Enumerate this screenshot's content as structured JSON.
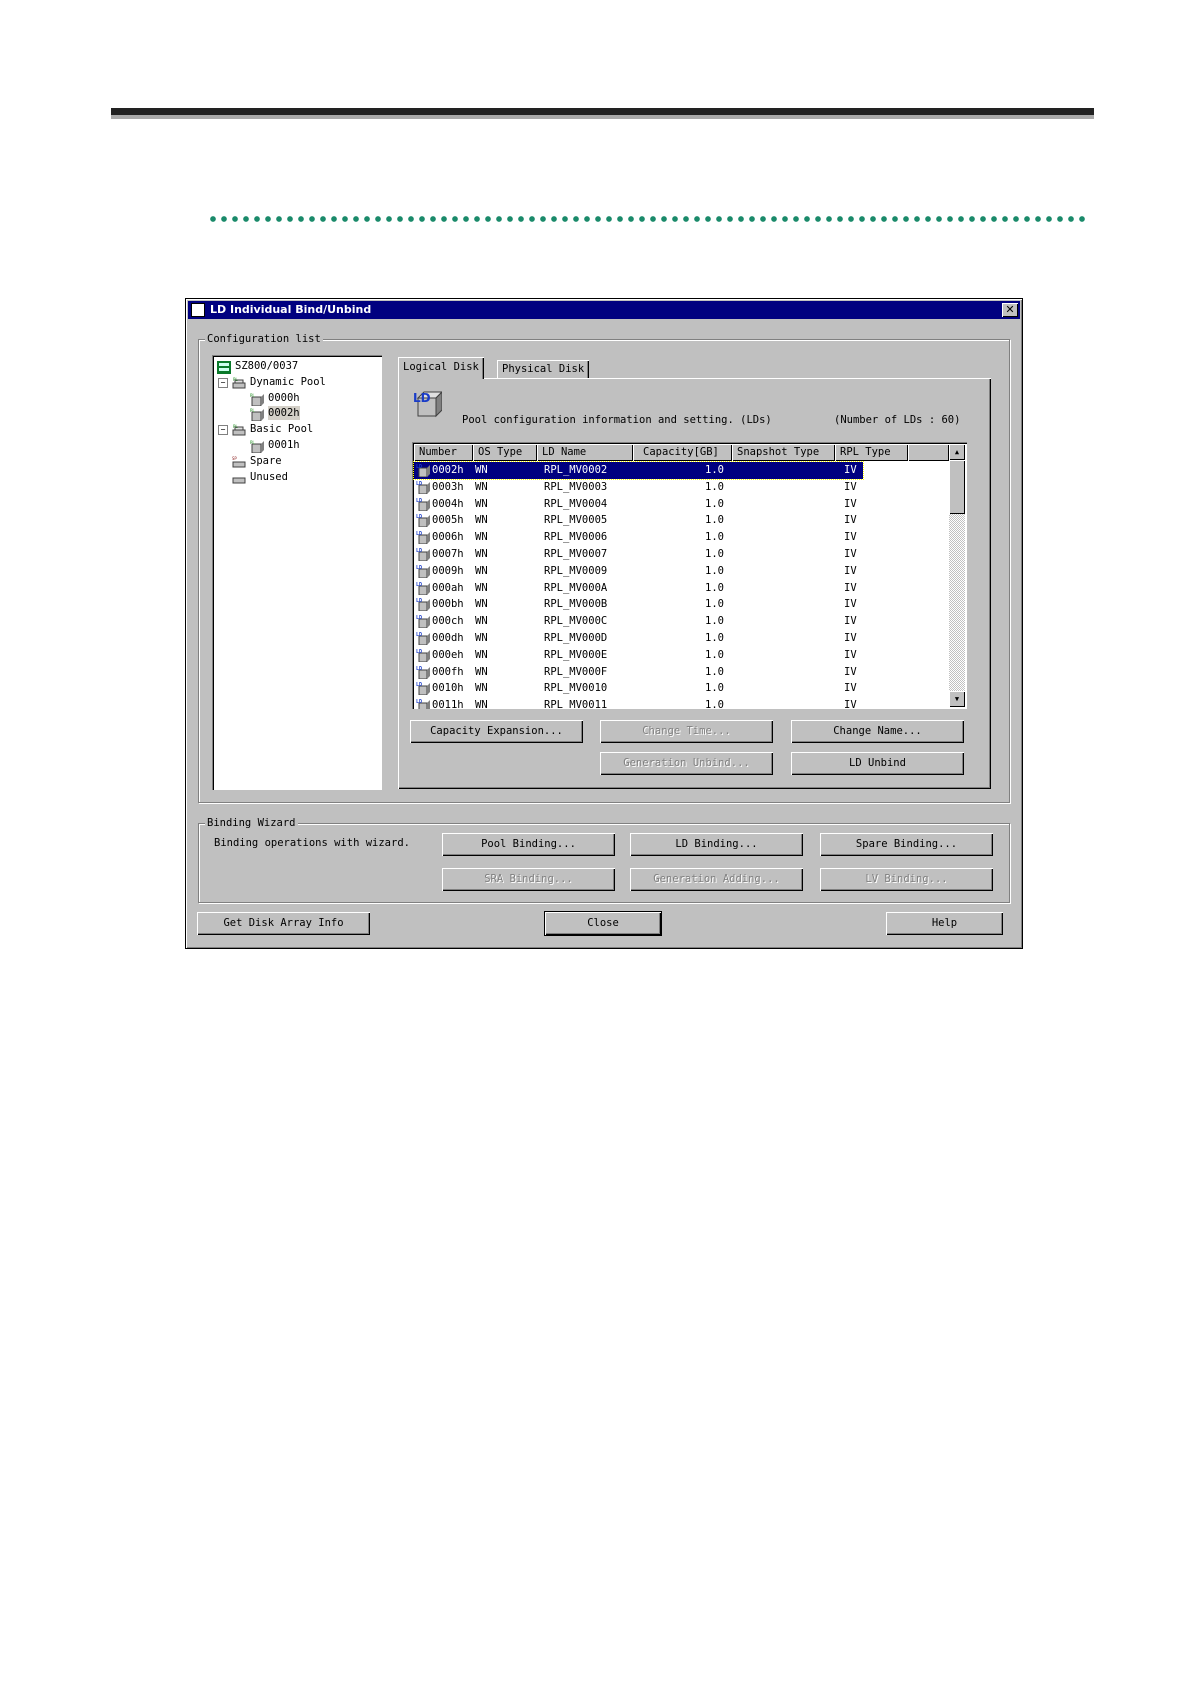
{
  "window": {
    "title": "LD Individual Bind/Unbind"
  },
  "config": {
    "group_label": "Configuration list",
    "tree": [
      {
        "label": "SZ800/0037",
        "icon": "disk-array-icon"
      },
      {
        "label": "Dynamic Pool",
        "icon": "pool-icon",
        "expander": "−"
      },
      {
        "label": "0000h",
        "icon": "pool-ld-icon"
      },
      {
        "label": "0002h",
        "icon": "pool-ld-icon",
        "selected": true
      },
      {
        "label": "Basic Pool",
        "icon": "pool-icon",
        "expander": "−"
      },
      {
        "label": "0001h",
        "icon": "pool-ld-icon"
      },
      {
        "label": "Spare",
        "icon": "spare-icon"
      },
      {
        "label": "Unused",
        "icon": "unused-icon"
      }
    ]
  },
  "tabs": [
    {
      "label": "Logical Disk",
      "active": true
    },
    {
      "label": "Physical Disk",
      "active": false
    }
  ],
  "panel": {
    "info": "Pool configuration information and setting. (LDs)",
    "count": "(Number of LDs : 60)",
    "icon_label": "LD"
  },
  "table": {
    "columns": [
      "Number",
      "OS Type",
      "LD Name",
      "Capacity[GB]",
      "Snapshot Type",
      "RPL Type"
    ],
    "rows": [
      [
        "0002h",
        "WN",
        "RPL_MV0002",
        "1.0",
        "",
        "IV"
      ],
      [
        "0003h",
        "WN",
        "RPL_MV0003",
        "1.0",
        "",
        "IV"
      ],
      [
        "0004h",
        "WN",
        "RPL_MV0004",
        "1.0",
        "",
        "IV"
      ],
      [
        "0005h",
        "WN",
        "RPL_MV0005",
        "1.0",
        "",
        "IV"
      ],
      [
        "0006h",
        "WN",
        "RPL_MV0006",
        "1.0",
        "",
        "IV"
      ],
      [
        "0007h",
        "WN",
        "RPL_MV0007",
        "1.0",
        "",
        "IV"
      ],
      [
        "0009h",
        "WN",
        "RPL_MV0009",
        "1.0",
        "",
        "IV"
      ],
      [
        "000ah",
        "WN",
        "RPL_MV000A",
        "1.0",
        "",
        "IV"
      ],
      [
        "000bh",
        "WN",
        "RPL_MV000B",
        "1.0",
        "",
        "IV"
      ],
      [
        "000ch",
        "WN",
        "RPL_MV000C",
        "1.0",
        "",
        "IV"
      ],
      [
        "000dh",
        "WN",
        "RPL_MV000D",
        "1.0",
        "",
        "IV"
      ],
      [
        "000eh",
        "WN",
        "RPL_MV000E",
        "1.0",
        "",
        "IV"
      ],
      [
        "000fh",
        "WN",
        "RPL_MV000F",
        "1.0",
        "",
        "IV"
      ],
      [
        "0010h",
        "WN",
        "RPL_MV0010",
        "1.0",
        "",
        "IV"
      ],
      [
        "0011h",
        "WN",
        "RPL_MV0011",
        "1.0",
        "",
        "IV"
      ]
    ]
  },
  "buttons": {
    "capacity_expansion": "Capacity Expansion...",
    "change_time": "Change Time...",
    "change_name": "Change Name...",
    "generation_unbind": "Generation Unbind...",
    "ld_unbind": "LD Unbind"
  },
  "wizard": {
    "group_label": "Binding Wizard",
    "text": "Binding operations with wizard.",
    "pool_binding": "Pool Binding...",
    "ld_binding": "LD Binding...",
    "spare_binding": "Spare Binding...",
    "sra_binding": "SRA Binding...",
    "generation_adding": "Generation Adding...",
    "lv_binding": "LV Binding..."
  },
  "footer": {
    "get_info": "Get Disk Array Info",
    "close": "Close",
    "help": "Help"
  },
  "colors": {
    "selection": "#000080",
    "face": "#c0c0c0",
    "accent_dots": "#1a8a6a"
  }
}
